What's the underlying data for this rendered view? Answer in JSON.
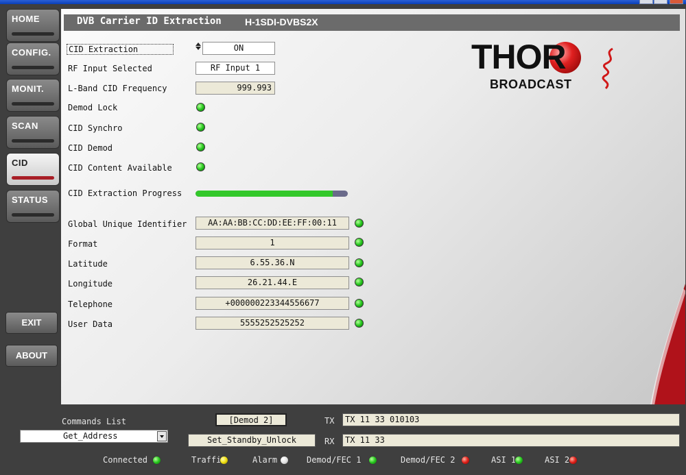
{
  "nav": {
    "home": "HOME",
    "config": "CONFIG.",
    "monit": "MONIT.",
    "scan": "SCAN",
    "cid": "CID",
    "status": "STATUS",
    "exit": "EXIT",
    "about": "ABOUT",
    "active": "CID"
  },
  "header": {
    "title": "DVB Carrier ID Extraction",
    "model": "H-1SDI-DVBS2X"
  },
  "logo": {
    "brand": "THOR",
    "sub": "BROADCAST"
  },
  "fields": {
    "cid_extraction": {
      "label": "CID Extraction",
      "value": "ON"
    },
    "rf_input": {
      "label": "RF Input Selected",
      "value": "RF Input 1"
    },
    "lband_freq": {
      "label": "L-Band CID Frequency",
      "value": "999.993"
    },
    "demod_lock": {
      "label": "Demod Lock",
      "status": "green"
    },
    "cid_synchro": {
      "label": "CID Synchro",
      "status": "green"
    },
    "cid_demod": {
      "label": "CID Demod",
      "status": "green"
    },
    "cid_content": {
      "label": "CID Content Available",
      "status": "green"
    },
    "progress": {
      "label": "CID Extraction Progress",
      "percent": 90
    },
    "guid": {
      "label": "Global Unique Identifier",
      "value": "AA:AA:BB:CC:DD:EE:FF:00:11",
      "status": "green"
    },
    "format": {
      "label": "Format",
      "value": "1",
      "status": "green"
    },
    "latitude": {
      "label": "Latitude",
      "value": "6.55.36.N",
      "status": "green"
    },
    "longitude": {
      "label": "Longitude",
      "value": "26.21.44.E",
      "status": "green"
    },
    "telephone": {
      "label": "Telephone",
      "value": "+000000223344556677",
      "status": "green"
    },
    "user_data": {
      "label": "User Data",
      "value": "5555252525252",
      "status": "green"
    }
  },
  "bottom": {
    "commands_label": "Commands List",
    "command_selected": "Get_Address",
    "demod_box": "[Demod 2]",
    "standby_box": "Set_Standby_Unlock",
    "tx_label": "TX",
    "tx_value": "TX 11 33 010103",
    "rx_label": "RX",
    "rx_value": "TX 11 33"
  },
  "status_bar": [
    {
      "label": "Connected",
      "color": "green"
    },
    {
      "label": "Traffi",
      "color": "yellow"
    },
    {
      "label": "Alarm",
      "color": "white"
    },
    {
      "label": "Demod/FEC 1",
      "color": "green"
    },
    {
      "label": "Demod/FEC 2",
      "color": "red"
    },
    {
      "label": "ASI 1",
      "color": "green"
    },
    {
      "label": "ASI 2",
      "color": "red"
    }
  ],
  "colors": {
    "led_green": "#28c81f",
    "led_red": "#e0201a",
    "led_yellow": "#f0e010",
    "active_bar": "#a81e26",
    "brand_red": "#d01818",
    "header_gray": "#6b6b6b"
  }
}
